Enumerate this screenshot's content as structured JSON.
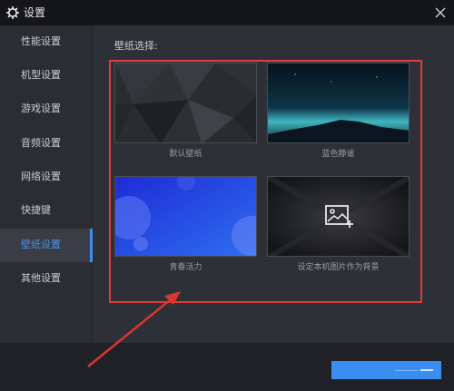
{
  "window": {
    "title": "设置"
  },
  "sidebar": {
    "items": [
      {
        "label": "性能设置",
        "active": false
      },
      {
        "label": "机型设置",
        "active": false
      },
      {
        "label": "游戏设置",
        "active": false
      },
      {
        "label": "音频设置",
        "active": false
      },
      {
        "label": "网络设置",
        "active": false
      },
      {
        "label": "快捷键",
        "active": false
      },
      {
        "label": "壁纸设置",
        "active": true
      },
      {
        "label": "其他设置",
        "active": false
      }
    ]
  },
  "main": {
    "section_label": "壁纸选择:",
    "wallpapers": [
      {
        "caption": "默认壁纸",
        "style": "dark-geometric"
      },
      {
        "caption": "蓝色静谧",
        "style": "blue-night-mountain"
      },
      {
        "caption": "青春活力",
        "style": "blue-bubbles"
      },
      {
        "caption": "设定本机图片作为背景",
        "style": "custom-image",
        "icon": "add-image-icon"
      }
    ]
  },
  "footer": {
    "confirm_button_label": ""
  },
  "colors": {
    "accent": "#3a8ef0",
    "highlight": "#e23b3b",
    "annotation_arrow": "#d9362f"
  }
}
